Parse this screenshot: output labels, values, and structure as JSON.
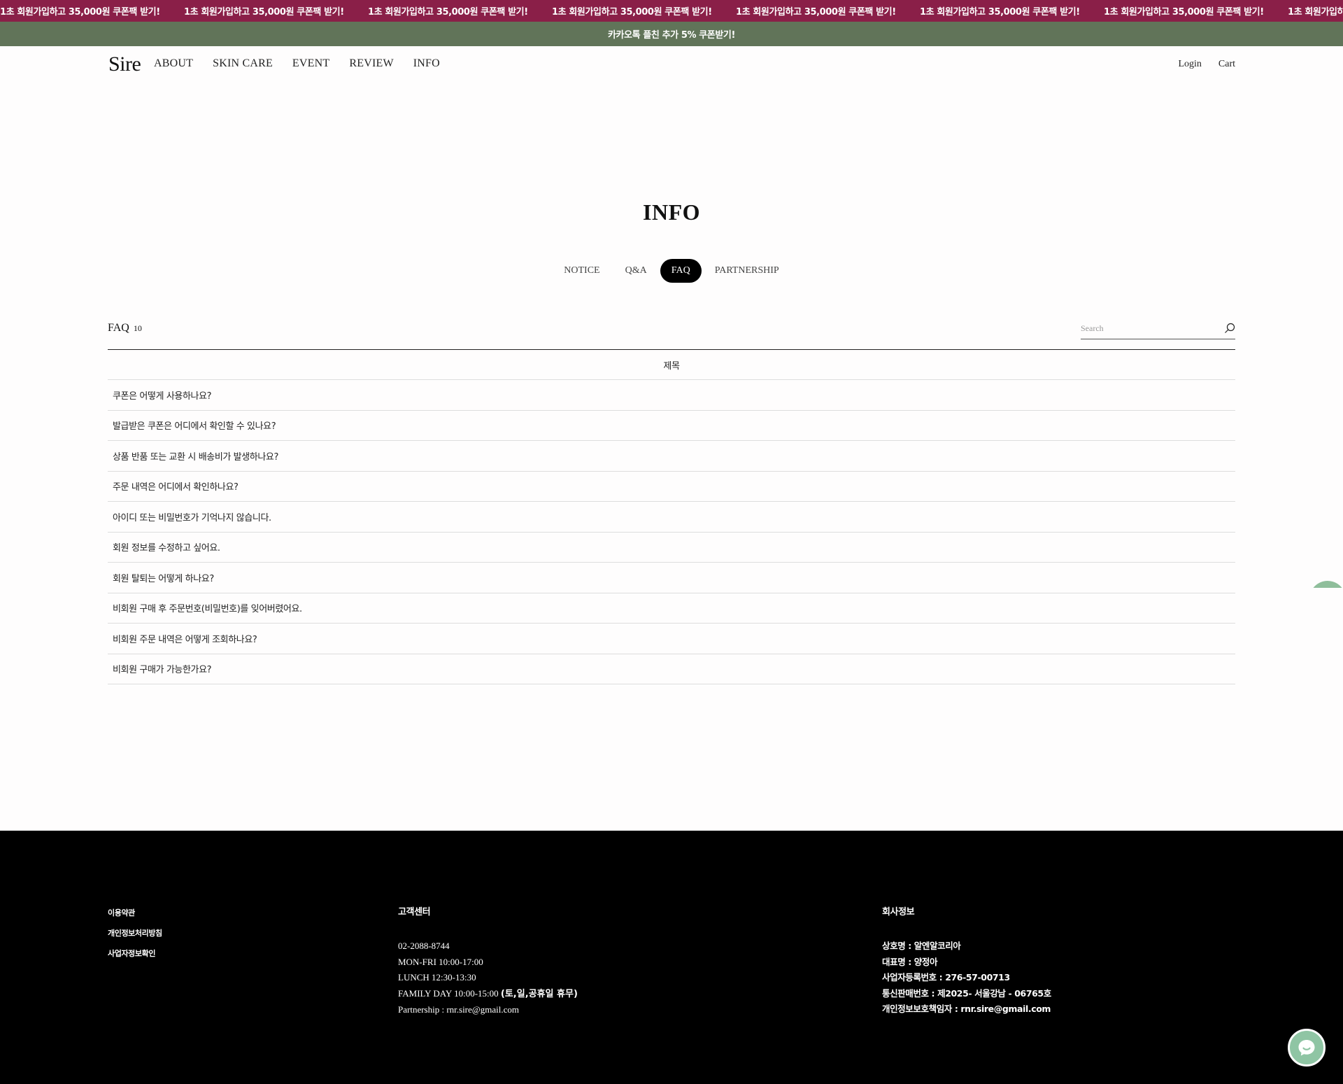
{
  "promo_marquee": {
    "text": "1초 회원가입하고 35,000원 쿠폰팩 받기!",
    "color": "#8a1f48"
  },
  "kakao_bar": {
    "text": "카카오톡 플친 추가 5% 쿠폰받기!",
    "color": "#617459"
  },
  "header": {
    "logo": "Sire",
    "nav": [
      "ABOUT",
      "SKIN CARE",
      "EVENT",
      "REVIEW",
      "INFO"
    ],
    "login": "Login",
    "cart": "Cart"
  },
  "page": {
    "title": "INFO",
    "tabs": [
      "NOTICE",
      "Q&A",
      "FAQ",
      "PARTNERSHIP"
    ],
    "active_tab": "FAQ"
  },
  "board": {
    "title": "FAQ",
    "count": "10",
    "search_placeholder": "Search",
    "column_header": "제목",
    "rows": [
      "쿠폰은 어떻게 사용하나요?",
      "발급받은 쿠폰은 어디에서 확인할 수 있나요?",
      "상품 반품 또는 교환 시 배송비가 발생하나요?",
      "주문 내역은 어디에서 확인하나요?",
      "아이디 또는 비밀번호가 기억나지 않습니다.",
      "회원 정보를 수정하고 싶어요.",
      "회원 탈퇴는 어떻게 하나요?",
      "비회원 구매 후 주문번호(비밀번호)를 잊어버렸어요.",
      "비회원 주문 내역은 어떻게 조회하나요?",
      "비회원 구매가 가능한가요?"
    ]
  },
  "footer": {
    "links": [
      "이용약관",
      "개인정보처리방침",
      "사업자정보확인"
    ],
    "customer_center": {
      "title": "고객센터",
      "phone": "02-2088-8744",
      "hours": "MON-FRI 10:00-17:00",
      "lunch": "LUNCH 12:30-13:30",
      "family_day_prefix": "FAMILY DAY 10:00-15:00 ",
      "family_day_suffix": "(토,일,공휴일 휴무)",
      "partnership": "Partnership : rnr.sire@gmail.com"
    },
    "company": {
      "title": "회사정보",
      "lines": [
        "상호명 : 알엔알코리아",
        "대표명 : 양정아",
        "사업자등록번호 : 276-57-00713",
        "통신판매번호 : 제2025- 서울강남 - 06765호",
        "개인정보보호책임자 : rnr.sire@gmail.com"
      ]
    }
  },
  "chat": {
    "icon": "chat-bubble-icon",
    "color": "#8fc5a4"
  }
}
